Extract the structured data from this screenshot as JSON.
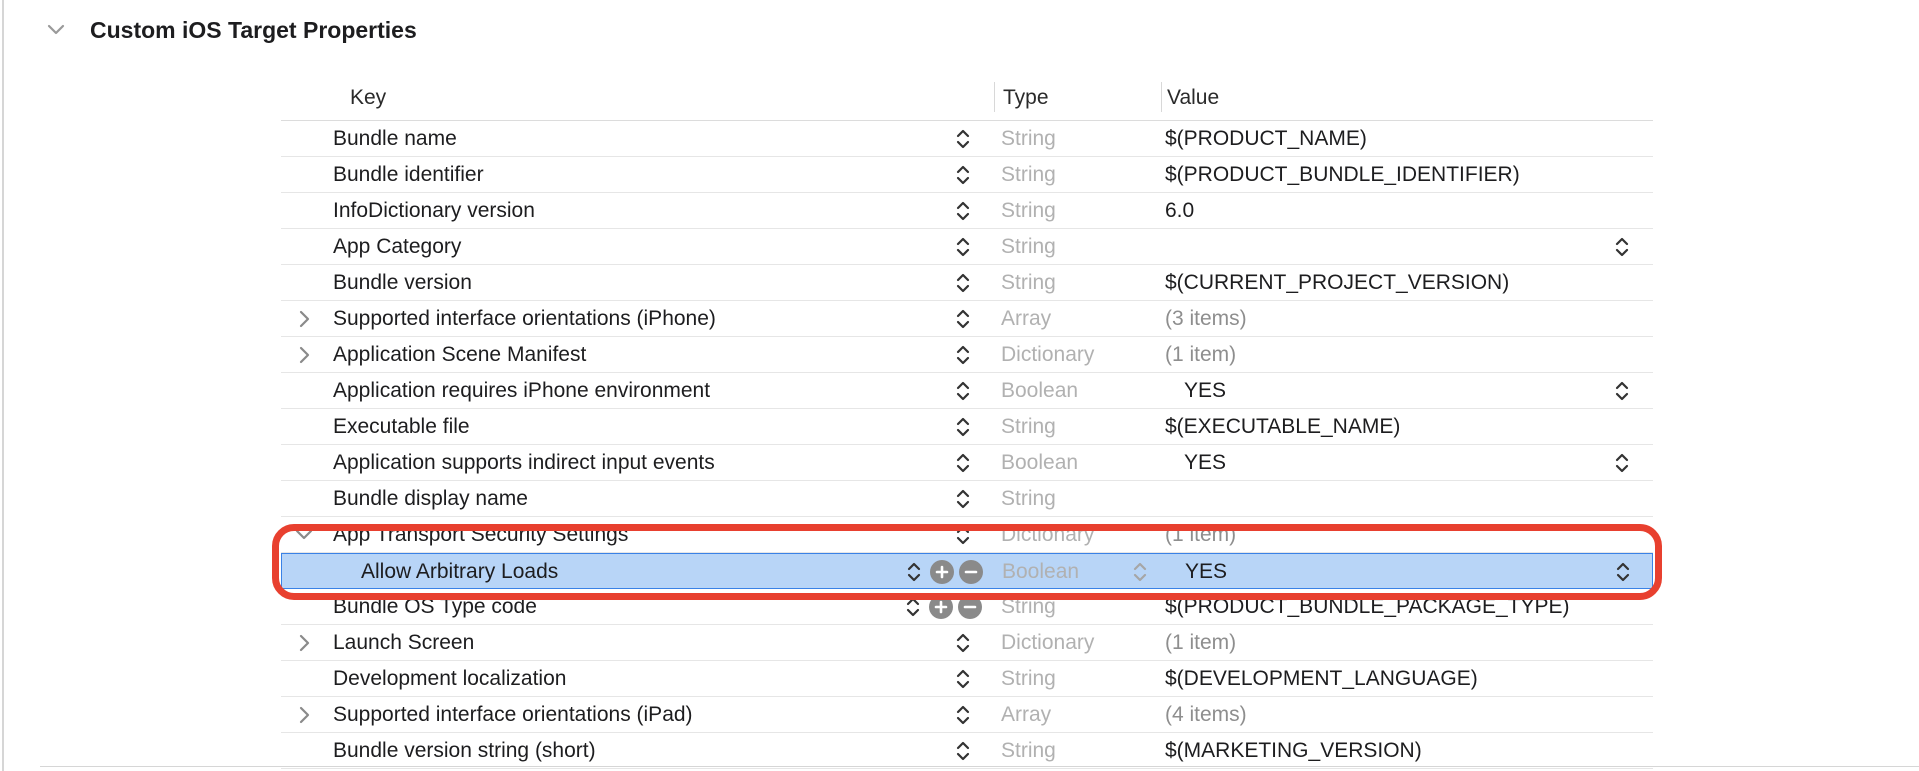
{
  "section": {
    "title": "Custom iOS Target Properties"
  },
  "columns": {
    "key": "Key",
    "type": "Type",
    "value": "Value"
  },
  "rows": [
    {
      "key": "Bundle name",
      "type": "String",
      "value": "$(PRODUCT_NAME)"
    },
    {
      "key": "Bundle identifier",
      "type": "String",
      "value": "$(PRODUCT_BUNDLE_IDENTIFIER)"
    },
    {
      "key": "InfoDictionary version",
      "type": "String",
      "value": "6.0"
    },
    {
      "key": "App Category",
      "type": "String",
      "value": ""
    },
    {
      "key": "Bundle version",
      "type": "String",
      "value": "$(CURRENT_PROJECT_VERSION)"
    },
    {
      "key": "Supported interface orientations (iPhone)",
      "type": "Array",
      "value": "(3 items)"
    },
    {
      "key": "Application Scene Manifest",
      "type": "Dictionary",
      "value": "(1 item)"
    },
    {
      "key": "Application requires iPhone environment",
      "type": "Boolean",
      "value": "YES"
    },
    {
      "key": "Executable file",
      "type": "String",
      "value": "$(EXECUTABLE_NAME)"
    },
    {
      "key": "Application supports indirect input events",
      "type": "Boolean",
      "value": "YES"
    },
    {
      "key": "Bundle display name",
      "type": "String",
      "value": ""
    },
    {
      "key": "App Transport Security Settings",
      "type": "Dictionary",
      "value": "(1 item)"
    },
    {
      "key": "Allow Arbitrary Loads",
      "type": "Boolean",
      "value": "YES"
    },
    {
      "key": "Bundle OS Type code",
      "type": "String",
      "value": "$(PRODUCT_BUNDLE_PACKAGE_TYPE)"
    },
    {
      "key": "Launch Screen",
      "type": "Dictionary",
      "value": "(1 item)"
    },
    {
      "key": "Development localization",
      "type": "String",
      "value": "$(DEVELOPMENT_LANGUAGE)"
    },
    {
      "key": "Supported interface orientations (iPad)",
      "type": "Array",
      "value": "(4 items)"
    },
    {
      "key": "Bundle version string (short)",
      "type": "String",
      "value": "$(MARKETING_VERSION)"
    }
  ],
  "colors": {
    "selection": "#b8d5f7",
    "selection_border": "#3a82e6",
    "highlight_ring": "#e8402f"
  },
  "icons": {
    "disclosure_expanded": "chevron-down-icon",
    "disclosure_collapsed": "chevron-right-icon",
    "stepper": "up-down-chevron-icon",
    "add": "plus-circle-icon",
    "remove": "minus-circle-icon"
  }
}
